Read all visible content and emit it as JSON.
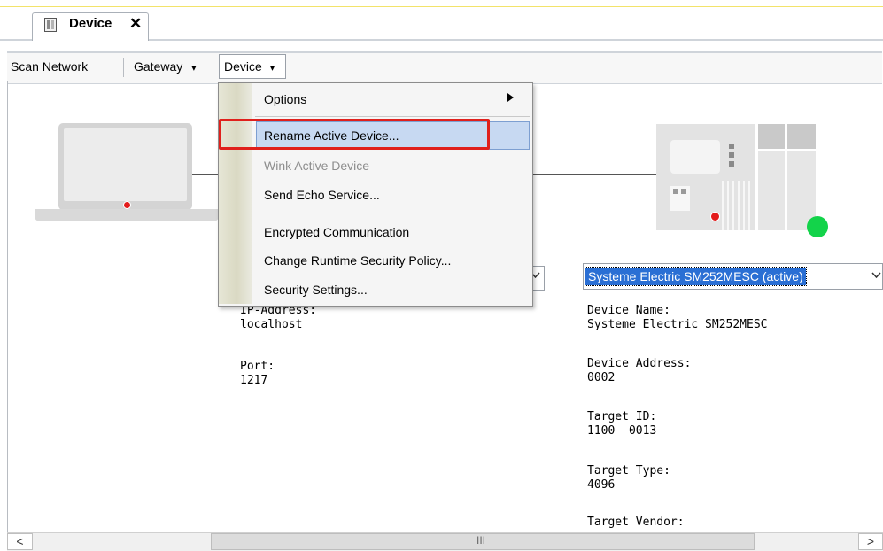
{
  "tab": {
    "label": "Device",
    "close_glyph": "✕",
    "icon": "device-icon"
  },
  "toolbar": {
    "scan_network": "Scan Network",
    "gateway": "Gateway",
    "device": "Device",
    "caret": "▾"
  },
  "menu": {
    "options": "Options",
    "rename": "Rename Active Device...",
    "wink": "Wink Active Device",
    "echo": "Send Echo Service...",
    "encrypted": "Encrypted Communication",
    "runtime_policy": "Change Runtime Security Policy...",
    "security_settings": "Security Settings..."
  },
  "gateway_info": {
    "ip_label": "IP-Address:",
    "ip_value": "localhost",
    "port_label": "Port:",
    "port_value": "1217"
  },
  "device_panel": {
    "selected": "Systeme Electric SM252MESC (active)",
    "name_label": "Device Name:",
    "name_value": "Systeme Electric SM252MESC",
    "address_label": "Device Address:",
    "address_value": "0002",
    "target_id_label": "Target ID:",
    "target_id_value": "1100  0013",
    "target_type_label": "Target Type:",
    "target_type_value": "4096",
    "target_vendor_label": "Target Vendor:"
  },
  "scrollbar": {
    "left": "<",
    "right": ">",
    "grip": "III"
  },
  "colors": {
    "highlight_border": "#e0201c",
    "status_green": "#13d34a",
    "selection_blue": "#2a6fd4"
  }
}
